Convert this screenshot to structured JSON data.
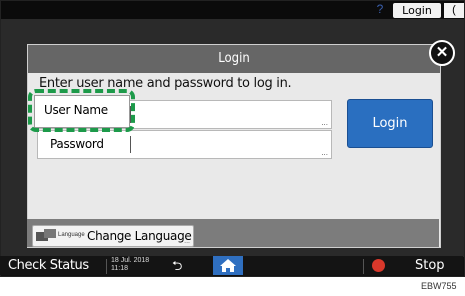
{
  "topbar": {
    "help_label": "?",
    "login_label": "Login",
    "moon_label": "("
  },
  "dialog": {
    "title": "Login",
    "close_label": "✕",
    "instruction": "Enter user name and password to log in.",
    "username_label": "User Name",
    "password_label": "Password",
    "login_button": "Login",
    "change_language_small": "Language",
    "change_language_label": "Change Language"
  },
  "statusbar": {
    "check_status": "Check Status",
    "date_line1": "18 Jul. 2018",
    "date_line2": "11:18",
    "stop_label": "Stop"
  },
  "footer": {
    "code": "EBW755"
  },
  "colors": {
    "accent": "#2a6fc0",
    "highlight": "#1d9a4a",
    "stop": "#d9382b"
  }
}
